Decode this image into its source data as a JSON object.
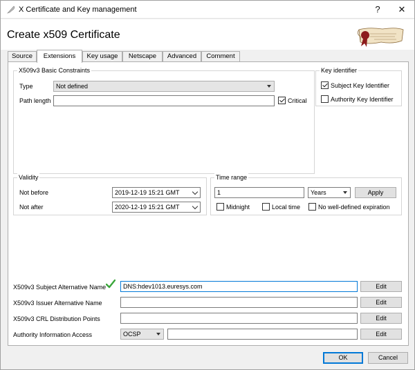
{
  "window": {
    "title": "X Certificate and Key management",
    "help_label": "?",
    "close_label": "✕",
    "heading": "Create x509 Certificate"
  },
  "tabs": [
    {
      "label": "Source"
    },
    {
      "label": "Extensions",
      "active": true
    },
    {
      "label": "Key usage"
    },
    {
      "label": "Netscape"
    },
    {
      "label": "Advanced"
    },
    {
      "label": "Comment"
    }
  ],
  "basic_constraints": {
    "group_title": "X509v3 Basic Constraints",
    "type_label": "Type",
    "type_value": "Not defined",
    "path_length_label": "Path length",
    "path_length_value": "",
    "critical_label": "Critical",
    "critical_checked": true
  },
  "key_identifier": {
    "group_title": "Key identifier",
    "subject_label": "Subject Key Identifier",
    "subject_checked": true,
    "authority_label": "Authority Key Identifier",
    "authority_checked": false
  },
  "validity": {
    "group_title": "Validity",
    "not_before_label": "Not before",
    "not_before_value": "2019-12-19 15:21 GMT",
    "not_after_label": "Not after",
    "not_after_value": "2020-12-19 15:21 GMT"
  },
  "time_range": {
    "group_title": "Time range",
    "amount_value": "1",
    "unit_value": "Years",
    "apply_label": "Apply",
    "midnight_label": "Midnight",
    "local_time_label": "Local time",
    "no_expiration_label": "No well-defined expiration"
  },
  "alt_names": {
    "san_label": "X509v3 Subject Alternative Name",
    "san_value": "DNS:hdev1013.euresys.com",
    "ian_label": "X509v3 Issuer Alternative Name",
    "ian_value": "",
    "crl_label": "X509v3 CRL Distribution Points",
    "crl_value": "",
    "aia_label": "Authority Information Access",
    "aia_method": "OCSP",
    "aia_value": "",
    "edit_label": "Edit"
  },
  "footer": {
    "ok_label": "OK",
    "cancel_label": "Cancel"
  },
  "colors": {
    "accent": "#0078d7",
    "check_green": "#3aa63a"
  }
}
